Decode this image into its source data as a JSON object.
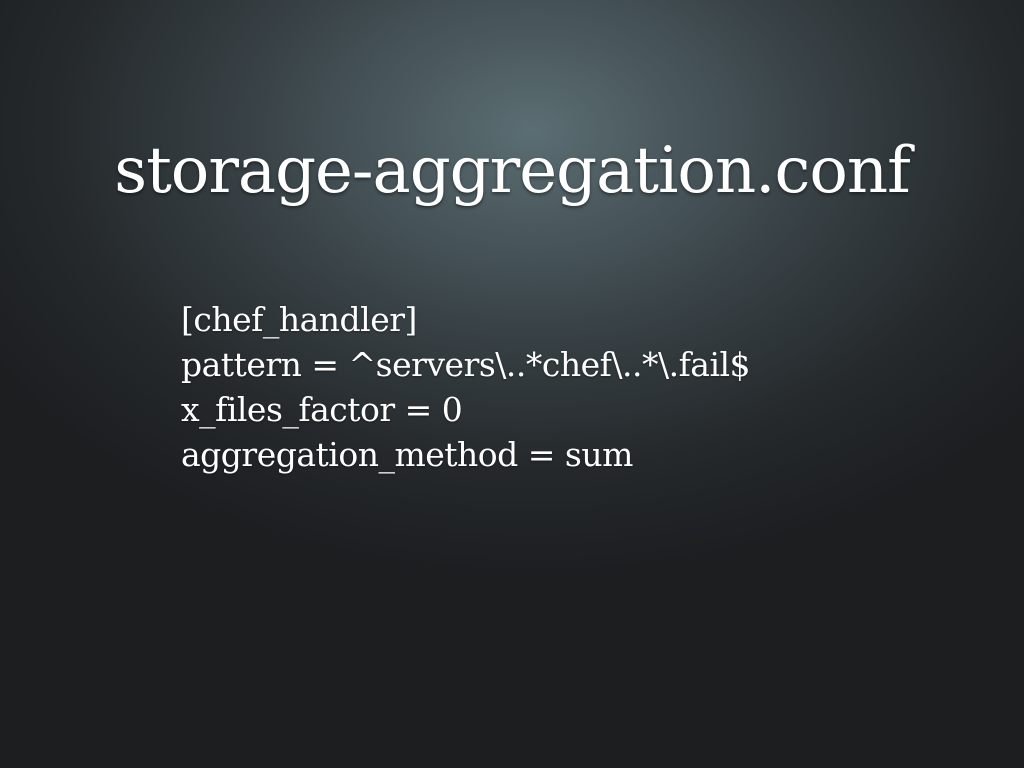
{
  "slide": {
    "title": "storage-aggregation.conf",
    "lines": [
      "[chef_handler]",
      "pattern = ^servers\\..*chef\\..*\\.fail$",
      "x_files_factor = 0",
      "aggregation_method = sum"
    ]
  },
  "colors": {
    "background_center": "#5b6e73",
    "background_edge": "#1c1e20",
    "text": "#ffffff"
  }
}
